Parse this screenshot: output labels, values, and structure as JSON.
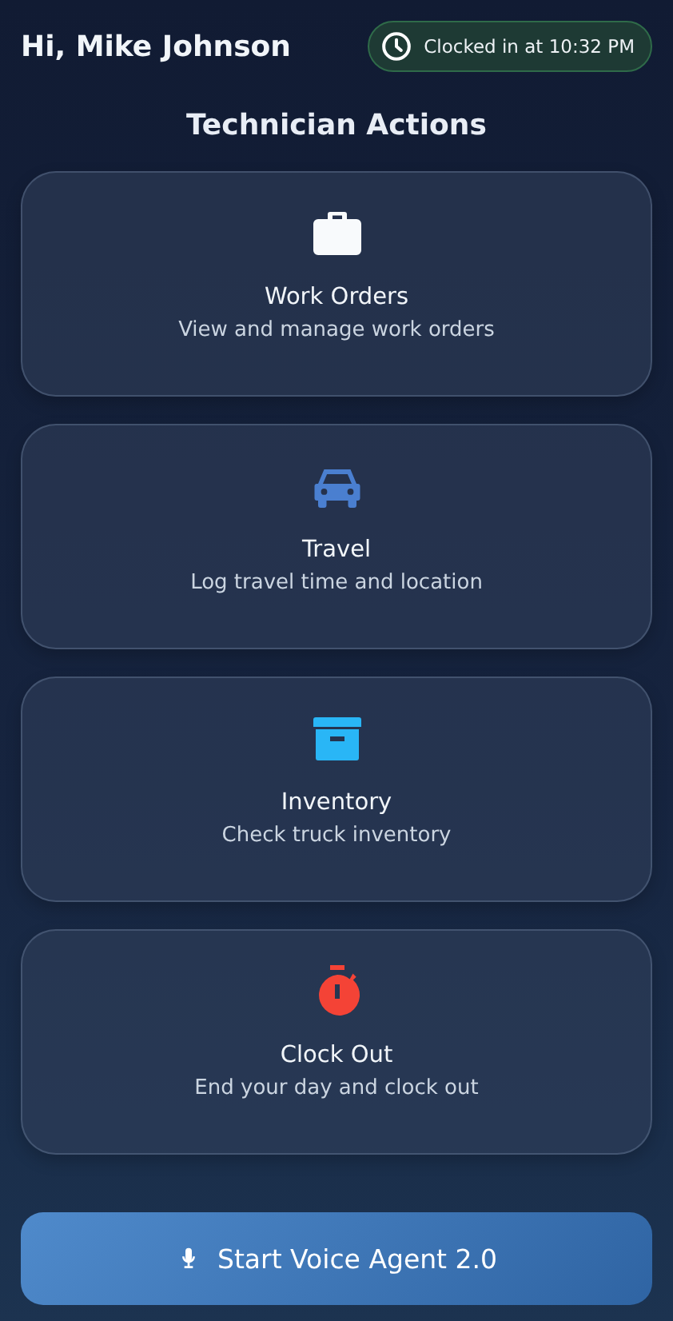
{
  "greeting": "Hi, Mike Johnson",
  "status_badge": {
    "text": "Clocked in at 10:32 PM"
  },
  "section_title": "Technician Actions",
  "actions": [
    {
      "kind": "briefcase",
      "color": "#f8fafc",
      "title": "Work Orders",
      "subtitle": "View and manage work orders"
    },
    {
      "kind": "car",
      "color": "#4a7fd0",
      "title": "Travel",
      "subtitle": "Log travel time and location"
    },
    {
      "kind": "archive",
      "color": "#29b6f6",
      "title": "Inventory",
      "subtitle": "Check truck inventory"
    },
    {
      "kind": "stopwatch",
      "color": "#f44336",
      "title": "Clock Out",
      "subtitle": "End your day and clock out"
    }
  ],
  "voice_button": {
    "label": "Start Voice Agent 2.0"
  }
}
